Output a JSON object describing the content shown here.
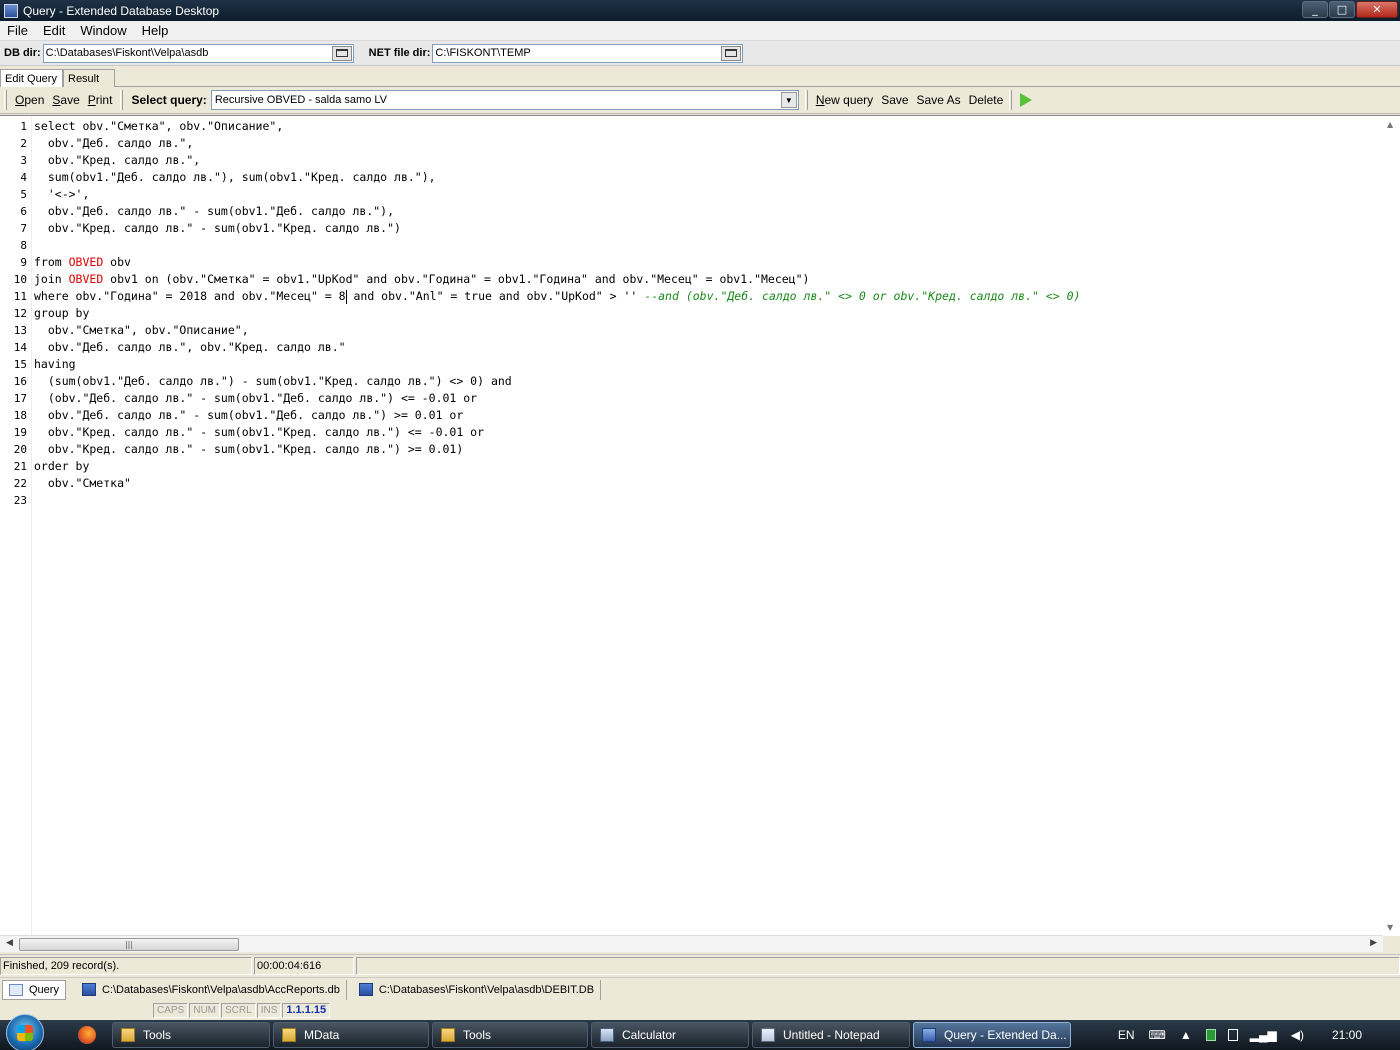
{
  "window": {
    "title": "Query - Extended Database Desktop",
    "controls": [
      "_",
      "□",
      "✕"
    ]
  },
  "menu": [
    "File",
    "Edit",
    "Window",
    "Help"
  ],
  "dirs": {
    "db_label": "DB dir:",
    "db_value": "C:\\Databases\\Fiskont\\Velpa\\asdb",
    "net_label": "NET file dir:",
    "net_value": "C:\\FISKONT\\TEMP"
  },
  "tabs": [
    "Edit Query",
    "Result"
  ],
  "toolbar": {
    "open": "Open",
    "save": "Save",
    "print": "Print",
    "select_label": "Select query:",
    "selected_query": "Recursive OBVED - salda samo LV",
    "new_query": "New query",
    "save2": "Save",
    "save_as": "Save As",
    "delete": "Delete"
  },
  "code_lines": [
    {
      "n": "1",
      "segs": [
        {
          "t": "select obv.\"Сметка\", obv.\"Описание\",",
          "c": ""
        }
      ]
    },
    {
      "n": "2",
      "segs": [
        {
          "t": "  obv.\"Деб. салдо лв.\",",
          "c": ""
        }
      ]
    },
    {
      "n": "3",
      "segs": [
        {
          "t": "  obv.\"Кред. салдо лв.\",",
          "c": ""
        }
      ]
    },
    {
      "n": "4",
      "segs": [
        {
          "t": "  sum(obv1.\"Деб. салдо лв.\"), sum(obv1.\"Кред. салдо лв.\"),",
          "c": ""
        }
      ]
    },
    {
      "n": "5",
      "segs": [
        {
          "t": "  '<->',",
          "c": ""
        }
      ]
    },
    {
      "n": "6",
      "segs": [
        {
          "t": "  obv.\"Деб. салдо лв.\" - sum(obv1.\"Деб. салдо лв.\"),",
          "c": ""
        }
      ]
    },
    {
      "n": "7",
      "segs": [
        {
          "t": "  obv.\"Кред. салдо лв.\" - sum(obv1.\"Кред. салдо лв.\")",
          "c": ""
        }
      ]
    },
    {
      "n": "8",
      "segs": [
        {
          "t": "",
          "c": ""
        }
      ]
    },
    {
      "n": "9",
      "segs": [
        {
          "t": "from ",
          "c": ""
        },
        {
          "t": "OBVED",
          "c": "kw-red"
        },
        {
          "t": " obv",
          "c": ""
        }
      ]
    },
    {
      "n": "10",
      "segs": [
        {
          "t": "join ",
          "c": ""
        },
        {
          "t": "OBVED",
          "c": "kw-red"
        },
        {
          "t": " obv1 on (obv.\"Сметка\" = obv1.\"UpKod\" and obv.\"Година\" = obv1.\"Година\" and obv.\"Месец\" = obv1.\"Месец\")",
          "c": ""
        }
      ]
    },
    {
      "n": "11",
      "segs": [
        {
          "t": "where obv.\"Година\" = 2018 and obv.\"Месец\" = 8",
          "c": ""
        },
        {
          "t": "",
          "c": "cursor"
        },
        {
          "t": " and obv.\"Anl\" = true and obv.\"UpKod\" > '' ",
          "c": ""
        },
        {
          "t": "--and (obv.\"Деб. салдо лв.\" <> 0 or obv.\"Кред. салдо лв.\" <> 0)",
          "c": "comment"
        }
      ]
    },
    {
      "n": "12",
      "segs": [
        {
          "t": "group by",
          "c": ""
        }
      ]
    },
    {
      "n": "13",
      "segs": [
        {
          "t": "  obv.\"Сметка\", obv.\"Описание\",",
          "c": ""
        }
      ]
    },
    {
      "n": "14",
      "segs": [
        {
          "t": "  obv.\"Деб. салдо лв.\", obv.\"Кред. салдо лв.\"",
          "c": ""
        }
      ]
    },
    {
      "n": "15",
      "segs": [
        {
          "t": "having",
          "c": ""
        }
      ]
    },
    {
      "n": "16",
      "segs": [
        {
          "t": "  (sum(obv1.\"Деб. салдо лв.\") - sum(obv1.\"Кред. салдо лв.\") <> 0) and",
          "c": ""
        }
      ]
    },
    {
      "n": "17",
      "segs": [
        {
          "t": "  (obv.\"Деб. салдо лв.\" - sum(obv1.\"Деб. салдо лв.\") <= -0.01 or",
          "c": ""
        }
      ]
    },
    {
      "n": "18",
      "segs": [
        {
          "t": "  obv.\"Деб. салдо лв.\" - sum(obv1.\"Деб. салдо лв.\") >= 0.01 or",
          "c": ""
        }
      ]
    },
    {
      "n": "19",
      "segs": [
        {
          "t": "  obv.\"Кред. салдо лв.\" - sum(obv1.\"Кред. салдо лв.\") <= -0.01 or",
          "c": ""
        }
      ]
    },
    {
      "n": "20",
      "segs": [
        {
          "t": "  obv.\"Кред. салдо лв.\" - sum(obv1.\"Кред. салдо лв.\") >= 0.01)",
          "c": ""
        }
      ]
    },
    {
      "n": "21",
      "segs": [
        {
          "t": "order by",
          "c": ""
        }
      ]
    },
    {
      "n": "22",
      "segs": [
        {
          "t": "  obv.\"Сметка\"",
          "c": ""
        }
      ]
    },
    {
      "n": "23",
      "segs": [
        {
          "t": "",
          "c": ""
        }
      ]
    }
  ],
  "status": {
    "message": "Finished, 209 record(s).",
    "elapsed": "00:00:04:616"
  },
  "window_tabs": [
    {
      "label": "Query",
      "icon": "query-icon"
    },
    {
      "label": "C:\\Databases\\Fiskont\\Velpa\\asdb\\AccReports.db",
      "icon": "database-icon"
    },
    {
      "label": "C:\\Databases\\Fiskont\\Velpa\\asdb\\DEBIT.DB",
      "icon": "database-icon"
    }
  ],
  "indicators": [
    "CAPS",
    "NUM",
    "SCRL",
    "INS"
  ],
  "version": "1.1.1.15",
  "taskbar": {
    "items": [
      {
        "label": "Tools",
        "icon": "folder-icon"
      },
      {
        "label": "MData",
        "icon": "folder-icon"
      },
      {
        "label": "Tools",
        "icon": "folder-icon"
      },
      {
        "label": "Calculator",
        "icon": "calculator-icon"
      },
      {
        "label": "Untitled - Notepad",
        "icon": "notepad-icon"
      },
      {
        "label": "Query - Extended Da...",
        "icon": "query-icon"
      }
    ],
    "language": "EN",
    "clock": "21:00"
  }
}
